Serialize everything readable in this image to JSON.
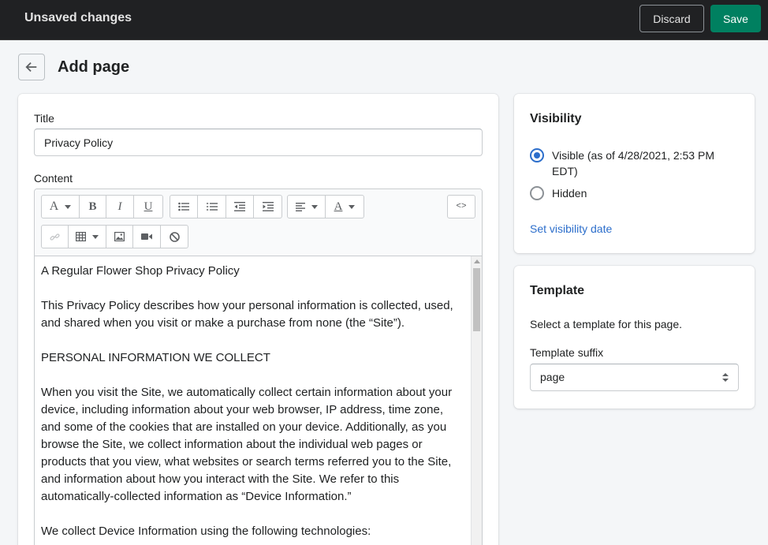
{
  "topbar": {
    "title": "Unsaved changes",
    "discard_label": "Discard",
    "save_label": "Save"
  },
  "page": {
    "title": "Add page"
  },
  "form": {
    "title_label": "Title",
    "title_value": "Privacy Policy",
    "content_label": "Content"
  },
  "toolbar": {
    "icons": [
      "font-icon",
      "bold-icon",
      "italic-icon",
      "underline-icon",
      "bullet-list-icon",
      "numbered-list-icon",
      "outdent-icon",
      "indent-icon",
      "align-left-icon",
      "text-color-icon",
      "html-code-icon",
      "link-icon",
      "table-icon",
      "image-icon",
      "video-icon",
      "clear-format-icon"
    ],
    "font_glyph": "A",
    "bold_glyph": "B",
    "italic_glyph": "I",
    "underline_glyph": "U",
    "text_color_glyph": "A",
    "code_glyph": "<>"
  },
  "editor": {
    "paragraphs": [
      "A Regular Flower Shop Privacy Policy",
      "This Privacy Policy describes how your personal information is collected, used, and shared when you visit or make a purchase from none (the “Site”).",
      "PERSONAL INFORMATION WE COLLECT",
      "When you visit the Site, we automatically collect certain information about your device, including information about your web browser, IP address, time zone, and some of the cookies that are installed on your device. Additionally, as you browse the Site, we collect information about the individual web pages or products that you view, what websites or search terms referred you to the Site, and information about how you interact with the Site. We refer to this automatically-collected information as “Device Information.”",
      "We collect Device Information using the following technologies:"
    ]
  },
  "visibility": {
    "title": "Visibility",
    "visible_label": "Visible (as of 4/28/2021, 2:53 PM EDT)",
    "hidden_label": "Hidden",
    "selected": "visible",
    "set_date_link": "Set visibility date"
  },
  "template": {
    "title": "Template",
    "description": "Select a template for this page.",
    "suffix_label": "Template suffix",
    "suffix_value": "page"
  },
  "colors": {
    "topbar_bg": "#202123",
    "save_green": "#008060",
    "link_blue": "#2c6ecb"
  }
}
